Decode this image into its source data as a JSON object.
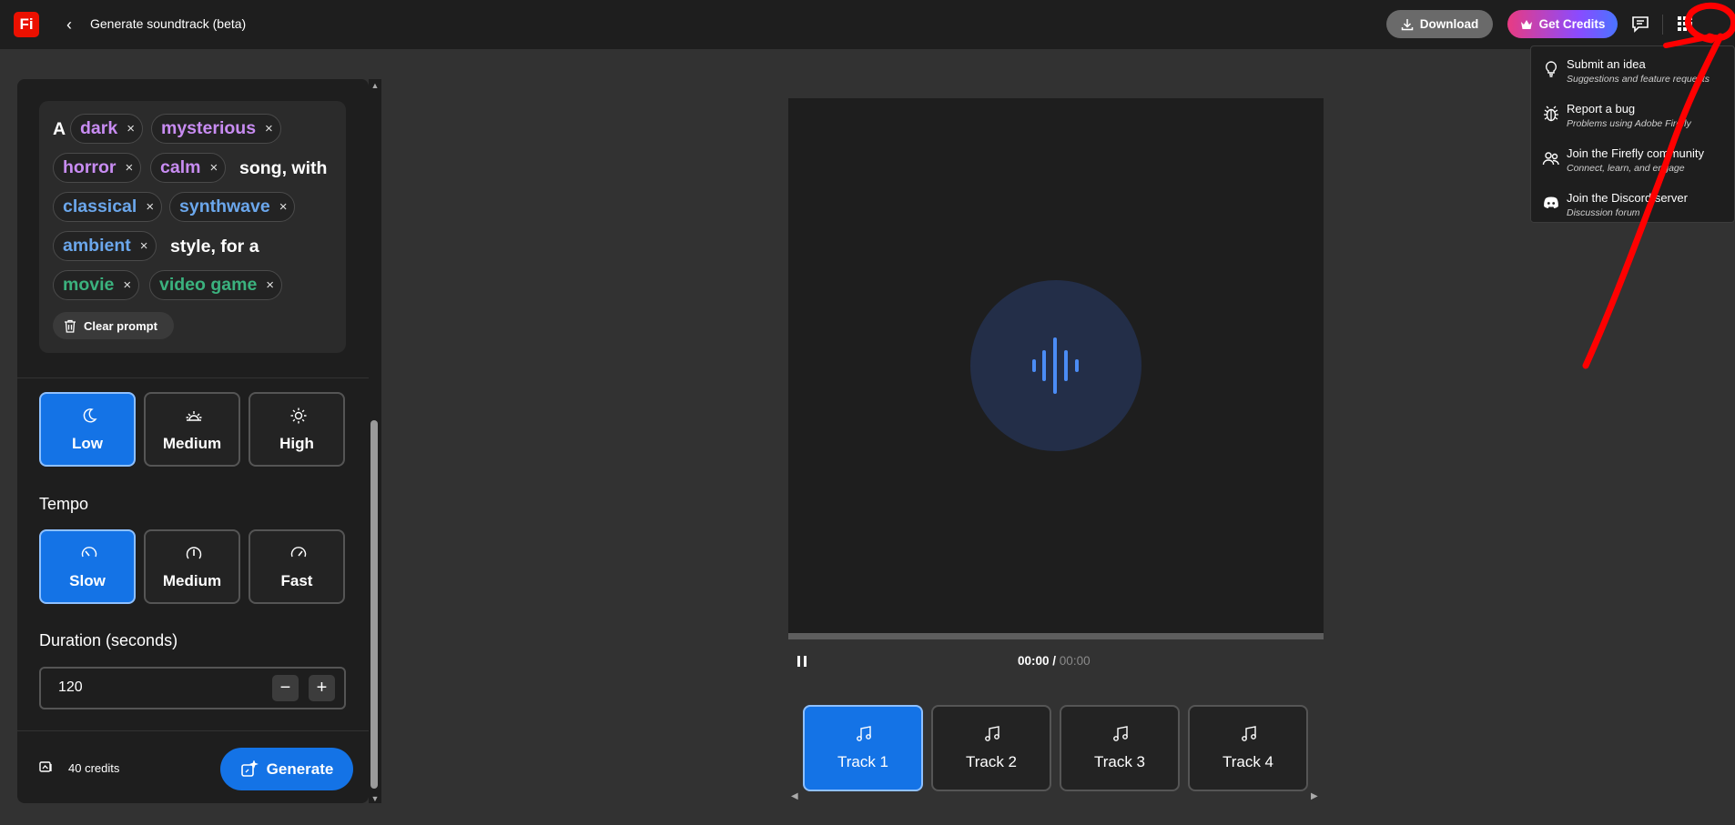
{
  "app": {
    "logo_text": "Fi",
    "back_label": "‹",
    "title": "Generate soundtrack (beta)"
  },
  "header": {
    "download_label": "Download",
    "get_credits_label": "Get Credits"
  },
  "menu": {
    "items": [
      {
        "title": "Submit an idea",
        "subtitle": "Suggestions and feature requests",
        "icon": "lightbulb-icon"
      },
      {
        "title": "Report a bug",
        "subtitle": "Problems using Adobe Firefly",
        "icon": "bug-icon"
      },
      {
        "title": "Join the Firefly community",
        "subtitle": "Connect, learn, and engage",
        "icon": "community-icon"
      },
      {
        "title": "Join the Discord server",
        "subtitle": "Discussion forum",
        "icon": "discord-icon"
      }
    ]
  },
  "prompt": {
    "prefix": "A",
    "chips": [
      {
        "label": "dark",
        "kind": "mood"
      },
      {
        "label": "mysterious",
        "kind": "mood"
      },
      {
        "label": "horror",
        "kind": "mood"
      },
      {
        "label": "calm",
        "kind": "mood"
      },
      {
        "label": "classical",
        "kind": "style"
      },
      {
        "label": "synthwave",
        "kind": "style"
      },
      {
        "label": "ambient",
        "kind": "style"
      },
      {
        "label": "movie",
        "kind": "purpose"
      },
      {
        "label": "video game",
        "kind": "purpose"
      }
    ],
    "text_song_with": "song, with",
    "text_style_for_a": "style, for a",
    "chip_remove": "×",
    "clear_label": "Clear prompt"
  },
  "energy": {
    "options": [
      {
        "label": "Low",
        "icon": "moon-icon",
        "selected": true
      },
      {
        "label": "Medium",
        "icon": "sunrise-icon",
        "selected": false
      },
      {
        "label": "High",
        "icon": "sun-icon",
        "selected": false
      }
    ]
  },
  "tempo": {
    "label": "Tempo",
    "options": [
      {
        "label": "Slow",
        "icon": "gauge-slow-icon",
        "selected": true
      },
      {
        "label": "Medium",
        "icon": "gauge-medium-icon",
        "selected": false
      },
      {
        "label": "Fast",
        "icon": "gauge-fast-icon",
        "selected": false
      }
    ]
  },
  "duration": {
    "label": "Duration (seconds)",
    "value": "120",
    "minus": "−",
    "plus": "+"
  },
  "footer": {
    "credits_text": "40 credits",
    "generate_label": "Generate"
  },
  "player": {
    "current_time": "00:00",
    "separator": " / ",
    "total_time": "00:00",
    "progress": 0
  },
  "tracks": [
    {
      "label": "Track 1",
      "selected": true
    },
    {
      "label": "Track 2",
      "selected": false
    },
    {
      "label": "Track 3",
      "selected": false
    },
    {
      "label": "Track 4",
      "selected": false
    }
  ],
  "colors": {
    "accent": "#1473e6",
    "mood_chip": "#c88cf2",
    "style_chip": "#6ba7ec",
    "purpose_chip": "#3bb27e",
    "annotation": "#ff0000"
  }
}
